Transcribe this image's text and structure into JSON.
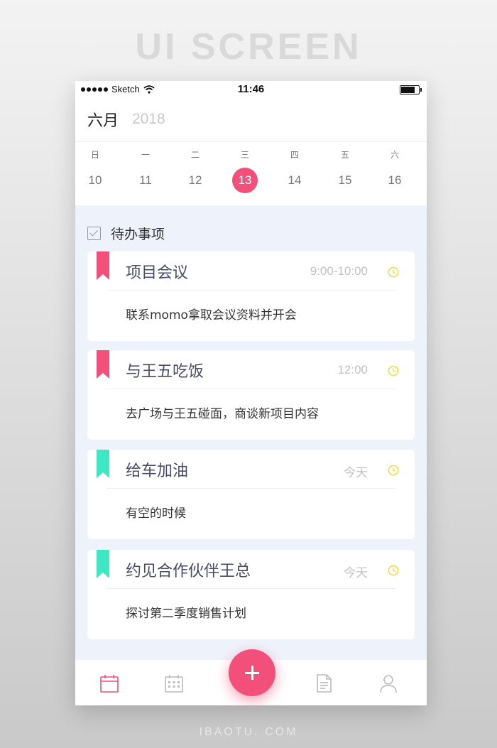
{
  "banner": "UI SCREEN",
  "footer": "IBAOTU. COM",
  "status_bar": {
    "carrier": "Sketch",
    "time": "11:46"
  },
  "header": {
    "month": "六月",
    "year": "2018"
  },
  "week": [
    {
      "name": "日",
      "date": "10",
      "active": false
    },
    {
      "name": "一",
      "date": "11",
      "active": false
    },
    {
      "name": "二",
      "date": "12",
      "active": false
    },
    {
      "name": "三",
      "date": "13",
      "active": true
    },
    {
      "name": "四",
      "date": "14",
      "active": false
    },
    {
      "name": "五",
      "date": "15",
      "active": false
    },
    {
      "name": "六",
      "date": "16",
      "active": false
    }
  ],
  "todo": {
    "title": "待办事项",
    "items": [
      {
        "title": "项目会议",
        "time": "9:00-10:00",
        "desc": "联系momo拿取会议资料并开会",
        "tag_color": "#f2507a"
      },
      {
        "title": "与王五吃饭",
        "time": "12:00",
        "desc": "去广场与王五碰面，商谈新项目内容",
        "tag_color": "#f2507a"
      },
      {
        "title": "给车加油",
        "time": "今天",
        "desc": "有空的时候",
        "tag_color": "#3fe7c2"
      },
      {
        "title": "约见合作伙伴王总",
        "time": "今天",
        "desc": "探讨第二季度销售计划",
        "tag_color": "#3fe7c2"
      }
    ]
  },
  "colors": {
    "accent": "#f2507a",
    "teal": "#3fe7c2",
    "clock": "#f5d94a"
  },
  "tabbar": {
    "icons": [
      "calendar-icon",
      "calendar-grid-icon",
      "add-icon",
      "document-icon",
      "user-icon"
    ]
  }
}
